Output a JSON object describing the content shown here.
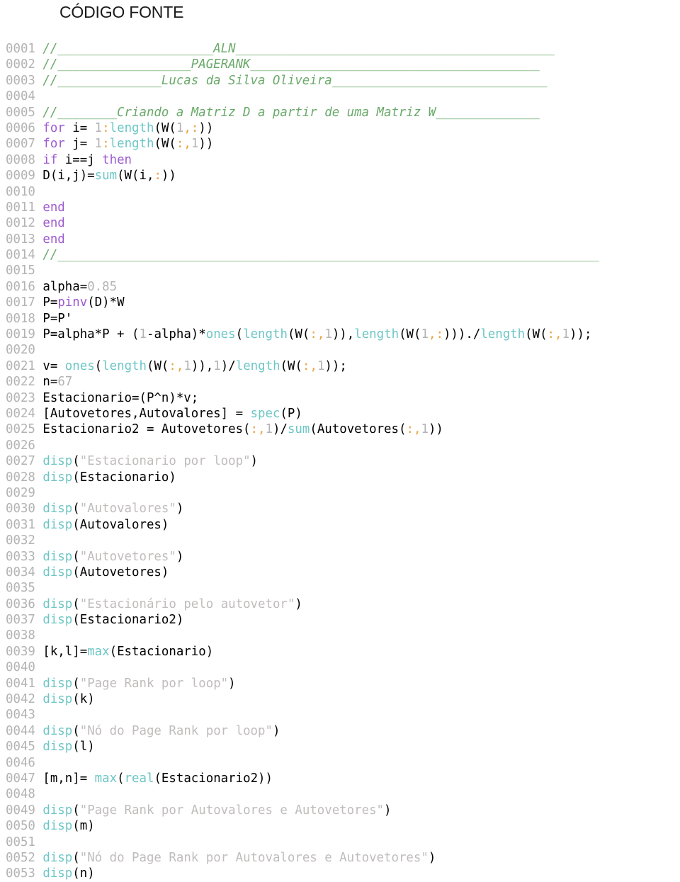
{
  "page": {
    "title": "CÓDIGO FONTE",
    "background": "#ffffff"
  },
  "colors": {
    "line_number": "#b3b3b3",
    "comment": "#6aa96a",
    "keyword": "#9e5ad1",
    "function": "#6ec6c6",
    "number": "#b3b3b3",
    "punctuation": "#e8a33d",
    "string": "#c0bcbc",
    "plain": "#000000"
  },
  "listing": {
    "language": "Scilab",
    "first_line": 1,
    "last_line": 53,
    "line_number_format": "0000",
    "lines": [
      {
        "n": "0001",
        "tokens": [
          {
            "t": "cmt",
            "s": "//_____________________ALN___________________________________________"
          }
        ]
      },
      {
        "n": "0002",
        "tokens": [
          {
            "t": "cmt",
            "s": "//__________________PAGERANK_______________________________________"
          }
        ]
      },
      {
        "n": "0003",
        "tokens": [
          {
            "t": "cmt",
            "s": "//______________Lucas da Silva Oliveira_____________________________"
          }
        ]
      },
      {
        "n": "0004",
        "tokens": []
      },
      {
        "n": "0005",
        "tokens": [
          {
            "t": "cmt",
            "s": "//________Criando a Matriz D a partir de uma Matriz W______________"
          }
        ]
      },
      {
        "n": "0006",
        "tokens": [
          {
            "t": "kw",
            "s": "for"
          },
          {
            "t": "plain",
            "s": " i= "
          },
          {
            "t": "num",
            "s": "1"
          },
          {
            "t": "punct",
            "s": ":"
          },
          {
            "t": "fn",
            "s": "length"
          },
          {
            "t": "plain",
            "s": "(W("
          },
          {
            "t": "num",
            "s": "1"
          },
          {
            "t": "punct",
            "s": ","
          },
          {
            "t": "punct",
            "s": ":"
          },
          {
            "t": "plain",
            "s": "))"
          }
        ]
      },
      {
        "n": "0007",
        "tokens": [
          {
            "t": "kw",
            "s": "for"
          },
          {
            "t": "plain",
            "s": " j= "
          },
          {
            "t": "num",
            "s": "1"
          },
          {
            "t": "punct",
            "s": ":"
          },
          {
            "t": "fn",
            "s": "length"
          },
          {
            "t": "plain",
            "s": "(W("
          },
          {
            "t": "punct",
            "s": ":"
          },
          {
            "t": "punct",
            "s": ","
          },
          {
            "t": "num",
            "s": "1"
          },
          {
            "t": "plain",
            "s": "))"
          }
        ]
      },
      {
        "n": "0008",
        "tokens": [
          {
            "t": "kw",
            "s": "if"
          },
          {
            "t": "plain",
            "s": " i==j "
          },
          {
            "t": "kw",
            "s": "then"
          }
        ]
      },
      {
        "n": "0009",
        "tokens": [
          {
            "t": "plain",
            "s": "D(i,j)="
          },
          {
            "t": "fn",
            "s": "sum"
          },
          {
            "t": "plain",
            "s": "(W(i,"
          },
          {
            "t": "punct",
            "s": ":"
          },
          {
            "t": "plain",
            "s": "))"
          }
        ]
      },
      {
        "n": "0010",
        "tokens": []
      },
      {
        "n": "0011",
        "tokens": [
          {
            "t": "kw",
            "s": "end"
          }
        ]
      },
      {
        "n": "0012",
        "tokens": [
          {
            "t": "kw",
            "s": "end"
          }
        ]
      },
      {
        "n": "0013",
        "tokens": [
          {
            "t": "kw",
            "s": "end"
          }
        ]
      },
      {
        "n": "0014",
        "tokens": [
          {
            "t": "cmt",
            "s": "//_________________________________________________________________________"
          }
        ]
      },
      {
        "n": "0015",
        "tokens": []
      },
      {
        "n": "0016",
        "tokens": [
          {
            "t": "plain",
            "s": "alpha="
          },
          {
            "t": "num",
            "s": "0.85"
          }
        ]
      },
      {
        "n": "0017",
        "tokens": [
          {
            "t": "plain",
            "s": "P="
          },
          {
            "t": "kw",
            "s": "pinv"
          },
          {
            "t": "plain",
            "s": "(D)*W"
          }
        ]
      },
      {
        "n": "0018",
        "tokens": [
          {
            "t": "plain",
            "s": "P=P'"
          }
        ]
      },
      {
        "n": "0019",
        "tokens": [
          {
            "t": "plain",
            "s": "P=alpha*P + ("
          },
          {
            "t": "num",
            "s": "1"
          },
          {
            "t": "plain",
            "s": "-alpha)*"
          },
          {
            "t": "fn",
            "s": "ones"
          },
          {
            "t": "plain",
            "s": "("
          },
          {
            "t": "fn",
            "s": "length"
          },
          {
            "t": "plain",
            "s": "(W("
          },
          {
            "t": "punct",
            "s": ":"
          },
          {
            "t": "punct",
            "s": ","
          },
          {
            "t": "num",
            "s": "1"
          },
          {
            "t": "plain",
            "s": ")),"
          },
          {
            "t": "fn",
            "s": "length"
          },
          {
            "t": "plain",
            "s": "(W("
          },
          {
            "t": "num",
            "s": "1"
          },
          {
            "t": "punct",
            "s": ","
          },
          {
            "t": "punct",
            "s": ":"
          },
          {
            "t": "plain",
            "s": ")))./"
          },
          {
            "t": "fn",
            "s": "length"
          },
          {
            "t": "plain",
            "s": "(W("
          },
          {
            "t": "punct",
            "s": ":"
          },
          {
            "t": "punct",
            "s": ","
          },
          {
            "t": "num",
            "s": "1"
          },
          {
            "t": "plain",
            "s": "));"
          }
        ]
      },
      {
        "n": "0020",
        "tokens": []
      },
      {
        "n": "0021",
        "tokens": [
          {
            "t": "plain",
            "s": "v= "
          },
          {
            "t": "fn",
            "s": "ones"
          },
          {
            "t": "plain",
            "s": "("
          },
          {
            "t": "fn",
            "s": "length"
          },
          {
            "t": "plain",
            "s": "(W("
          },
          {
            "t": "punct",
            "s": ":"
          },
          {
            "t": "punct",
            "s": ","
          },
          {
            "t": "num",
            "s": "1"
          },
          {
            "t": "plain",
            "s": ")),"
          },
          {
            "t": "num",
            "s": "1"
          },
          {
            "t": "plain",
            "s": ")/"
          },
          {
            "t": "fn",
            "s": "length"
          },
          {
            "t": "plain",
            "s": "(W("
          },
          {
            "t": "punct",
            "s": ":"
          },
          {
            "t": "punct",
            "s": ","
          },
          {
            "t": "num",
            "s": "1"
          },
          {
            "t": "plain",
            "s": "));"
          }
        ]
      },
      {
        "n": "0022",
        "tokens": [
          {
            "t": "plain",
            "s": "n="
          },
          {
            "t": "num",
            "s": "67"
          }
        ]
      },
      {
        "n": "0023",
        "tokens": [
          {
            "t": "plain",
            "s": "Estacionario=(P^n)*v;"
          }
        ]
      },
      {
        "n": "0024",
        "tokens": [
          {
            "t": "plain",
            "s": "[Autovetores,Autovalores] = "
          },
          {
            "t": "fn",
            "s": "spec"
          },
          {
            "t": "plain",
            "s": "(P)"
          }
        ]
      },
      {
        "n": "0025",
        "tokens": [
          {
            "t": "plain",
            "s": "Estacionario2 = Autovetores("
          },
          {
            "t": "punct",
            "s": ":"
          },
          {
            "t": "punct",
            "s": ","
          },
          {
            "t": "num",
            "s": "1"
          },
          {
            "t": "plain",
            "s": ")/"
          },
          {
            "t": "fn",
            "s": "sum"
          },
          {
            "t": "plain",
            "s": "(Autovetores("
          },
          {
            "t": "punct",
            "s": ":"
          },
          {
            "t": "punct",
            "s": ","
          },
          {
            "t": "num",
            "s": "1"
          },
          {
            "t": "plain",
            "s": "))"
          }
        ]
      },
      {
        "n": "0026",
        "tokens": []
      },
      {
        "n": "0027",
        "tokens": [
          {
            "t": "fn",
            "s": "disp"
          },
          {
            "t": "plain",
            "s": "("
          },
          {
            "t": "str",
            "s": "\"Estacionario por loop\""
          },
          {
            "t": "plain",
            "s": ")"
          }
        ]
      },
      {
        "n": "0028",
        "tokens": [
          {
            "t": "fn",
            "s": "disp"
          },
          {
            "t": "plain",
            "s": "(Estacionario)"
          }
        ]
      },
      {
        "n": "0029",
        "tokens": []
      },
      {
        "n": "0030",
        "tokens": [
          {
            "t": "fn",
            "s": "disp"
          },
          {
            "t": "plain",
            "s": "("
          },
          {
            "t": "str",
            "s": "\"Autovalores\""
          },
          {
            "t": "plain",
            "s": ")"
          }
        ]
      },
      {
        "n": "0031",
        "tokens": [
          {
            "t": "fn",
            "s": "disp"
          },
          {
            "t": "plain",
            "s": "(Autovalores)"
          }
        ]
      },
      {
        "n": "0032",
        "tokens": []
      },
      {
        "n": "0033",
        "tokens": [
          {
            "t": "fn",
            "s": "disp"
          },
          {
            "t": "plain",
            "s": "("
          },
          {
            "t": "str",
            "s": "\"Autovetores\""
          },
          {
            "t": "plain",
            "s": ")"
          }
        ]
      },
      {
        "n": "0034",
        "tokens": [
          {
            "t": "fn",
            "s": "disp"
          },
          {
            "t": "plain",
            "s": "(Autovetores)"
          }
        ]
      },
      {
        "n": "0035",
        "tokens": []
      },
      {
        "n": "0036",
        "tokens": [
          {
            "t": "fn",
            "s": "disp"
          },
          {
            "t": "plain",
            "s": "("
          },
          {
            "t": "str",
            "s": "\"Estacionário pelo autovetor\""
          },
          {
            "t": "plain",
            "s": ")"
          }
        ]
      },
      {
        "n": "0037",
        "tokens": [
          {
            "t": "fn",
            "s": "disp"
          },
          {
            "t": "plain",
            "s": "(Estacionario2)"
          }
        ]
      },
      {
        "n": "0038",
        "tokens": []
      },
      {
        "n": "0039",
        "tokens": [
          {
            "t": "plain",
            "s": "[k,l]="
          },
          {
            "t": "fn",
            "s": "max"
          },
          {
            "t": "plain",
            "s": "(Estacionario)"
          }
        ]
      },
      {
        "n": "0040",
        "tokens": []
      },
      {
        "n": "0041",
        "tokens": [
          {
            "t": "fn",
            "s": "disp"
          },
          {
            "t": "plain",
            "s": "("
          },
          {
            "t": "str",
            "s": "\"Page Rank por loop\""
          },
          {
            "t": "plain",
            "s": ")"
          }
        ]
      },
      {
        "n": "0042",
        "tokens": [
          {
            "t": "fn",
            "s": "disp"
          },
          {
            "t": "plain",
            "s": "(k)"
          }
        ]
      },
      {
        "n": "0043",
        "tokens": []
      },
      {
        "n": "0044",
        "tokens": [
          {
            "t": "fn",
            "s": "disp"
          },
          {
            "t": "plain",
            "s": "("
          },
          {
            "t": "str",
            "s": "\"Nó do Page Rank por loop\""
          },
          {
            "t": "plain",
            "s": ")"
          }
        ]
      },
      {
        "n": "0045",
        "tokens": [
          {
            "t": "fn",
            "s": "disp"
          },
          {
            "t": "plain",
            "s": "(l)"
          }
        ]
      },
      {
        "n": "0046",
        "tokens": []
      },
      {
        "n": "0047",
        "tokens": [
          {
            "t": "plain",
            "s": "[m,n]= "
          },
          {
            "t": "fn",
            "s": "max"
          },
          {
            "t": "plain",
            "s": "("
          },
          {
            "t": "fn",
            "s": "real"
          },
          {
            "t": "plain",
            "s": "(Estacionario2))"
          }
        ]
      },
      {
        "n": "0048",
        "tokens": []
      },
      {
        "n": "0049",
        "tokens": [
          {
            "t": "fn",
            "s": "disp"
          },
          {
            "t": "plain",
            "s": "("
          },
          {
            "t": "str",
            "s": "\"Page Rank por Autovalores e Autovetores\""
          },
          {
            "t": "plain",
            "s": ")"
          }
        ]
      },
      {
        "n": "0050",
        "tokens": [
          {
            "t": "fn",
            "s": "disp"
          },
          {
            "t": "plain",
            "s": "(m)"
          }
        ]
      },
      {
        "n": "0051",
        "tokens": []
      },
      {
        "n": "0052",
        "tokens": [
          {
            "t": "fn",
            "s": "disp"
          },
          {
            "t": "plain",
            "s": "("
          },
          {
            "t": "str",
            "s": "\"Nó do Page Rank por Autovalores e Autovetores\""
          },
          {
            "t": "plain",
            "s": ")"
          }
        ]
      },
      {
        "n": "0053",
        "tokens": [
          {
            "t": "fn",
            "s": "disp"
          },
          {
            "t": "plain",
            "s": "(n)"
          }
        ]
      }
    ]
  }
}
